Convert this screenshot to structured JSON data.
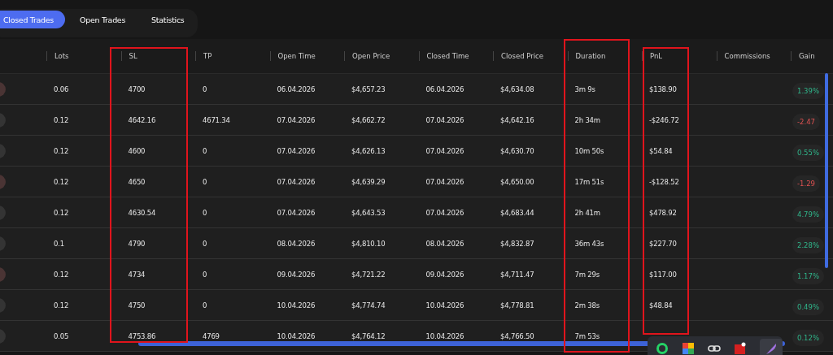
{
  "tabs": [
    {
      "label": "Closed Trades",
      "selected": true
    },
    {
      "label": "Open Trades",
      "selected": false
    },
    {
      "label": "Statistics",
      "selected": false
    }
  ],
  "columns": [
    "Lots",
    "SL",
    "TP",
    "Open Time",
    "Open Price",
    "Closed Time",
    "Closed Price",
    "Duration",
    "PnL",
    "Commissions",
    "Gain"
  ],
  "rows": [
    {
      "color": "#4a3434",
      "cells": [
        "0.06",
        "4700",
        "0",
        "06.04.2026",
        "$4,657.23",
        "06.04.2026",
        "$4,634.08",
        "3m 9s",
        "$138.90",
        ""
      ],
      "gain": "1.39%",
      "kind": "up"
    },
    {
      "color": "#343434",
      "cells": [
        "0.12",
        "4642.16",
        "4671.34",
        "07.04.2026",
        "$4,662.72",
        "07.04.2026",
        "$4,642.16",
        "2h 34m",
        "-$246.72",
        ""
      ],
      "gain": "-2.47",
      "kind": "down"
    },
    {
      "color": "#343434",
      "cells": [
        "0.12",
        "4600",
        "0",
        "07.04.2026",
        "$4,626.13",
        "07.04.2026",
        "$4,630.70",
        "10m 50s",
        "$54.84",
        ""
      ],
      "gain": "0.55%",
      "kind": "up"
    },
    {
      "color": "#4a3434",
      "cells": [
        "0.12",
        "4650",
        "0",
        "07.04.2026",
        "$4,639.29",
        "07.04.2026",
        "$4,650.00",
        "17m 51s",
        "-$128.52",
        ""
      ],
      "gain": "-1.29",
      "kind": "down"
    },
    {
      "color": "#343434",
      "cells": [
        "0.12",
        "4630.54",
        "0",
        "07.04.2026",
        "$4,643.53",
        "07.04.2026",
        "$4,683.44",
        "2h 41m",
        "$478.92",
        ""
      ],
      "gain": "4.79%",
      "kind": "up"
    },
    {
      "color": "#343434",
      "cells": [
        "0.1",
        "4790",
        "0",
        "08.04.2026",
        "$4,810.10",
        "08.04.2026",
        "$4,832.87",
        "36m 43s",
        "$227.70",
        ""
      ],
      "gain": "2.28%",
      "kind": "up"
    },
    {
      "color": "#4a3434",
      "cells": [
        "0.12",
        "4734",
        "0",
        "09.04.2026",
        "$4,721.22",
        "09.04.2026",
        "$4,711.47",
        "7m 29s",
        "$117.00",
        ""
      ],
      "gain": "1.17%",
      "kind": "up"
    },
    {
      "color": "#343434",
      "cells": [
        "0.12",
        "4750",
        "0",
        "10.04.2026",
        "$4,774.74",
        "10.04.2026",
        "$4,778.81",
        "2m 38s",
        "$48.84",
        ""
      ],
      "gain": "0.49%",
      "kind": "up"
    },
    {
      "color": "#343434",
      "cells": [
        "0.05",
        "4753.86",
        "4769",
        "10.04.2026",
        "$4,764.12",
        "10.04.2026",
        "$4,766.50",
        "7m 53s",
        "",
        ""
      ],
      "gain": "0.12%",
      "kind": "up"
    }
  ]
}
